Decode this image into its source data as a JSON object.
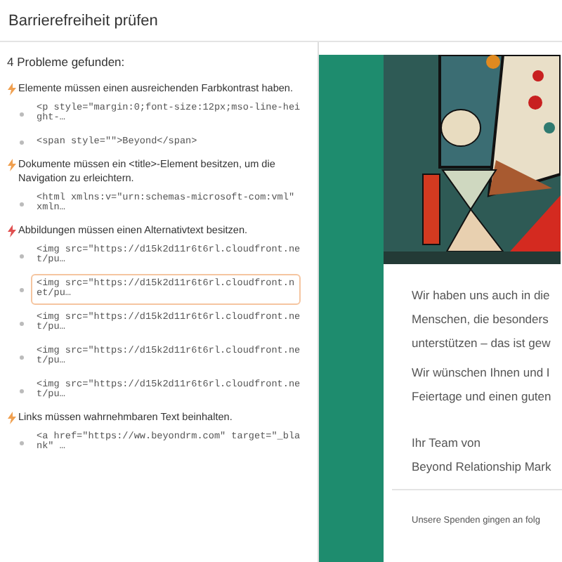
{
  "window": {
    "title": "Barrierefreiheit prüfen"
  },
  "summary": "4 Probleme gefunden:",
  "issues": [
    {
      "color": "#f0a050",
      "text": "Elemente müssen einen ausreichenden Farbkontrast haben.",
      "nodes": [
        {
          "code": "<p style=\"margin:0;font-size:12px;mso-line-height-…",
          "selected": false
        },
        {
          "code": "<span style=\"\">Beyond</span>",
          "selected": false
        }
      ]
    },
    {
      "color": "#f0a050",
      "text": "Dokumente müssen ein <title>-Element besitzen, um die Navigation zu erleichtern.",
      "nodes": [
        {
          "code": "<html xmlns:v=\"urn:schemas-microsoft-com:vml\" xmln…",
          "selected": false
        }
      ]
    },
    {
      "color": "#e05050",
      "text": "Abbildungen müssen einen Alternativtext besitzen.",
      "nodes": [
        {
          "code": "<img src=\"https://d15k2d11r6t6rl.cloudfront.net/pu…",
          "selected": false
        },
        {
          "code": "<img src=\"https://d15k2d11r6t6rl.cloudfront.net/pu…",
          "selected": true
        },
        {
          "code": "<img src=\"https://d15k2d11r6t6rl.cloudfront.net/pu…",
          "selected": false
        },
        {
          "code": "<img src=\"https://d15k2d11r6t6rl.cloudfront.net/pu…",
          "selected": false
        },
        {
          "code": "<img src=\"https://d15k2d11r6t6rl.cloudfront.net/pu…",
          "selected": false
        }
      ]
    },
    {
      "color": "#f0a050",
      "text": "Links müssen wahrnehmbaren Text beinhalten.",
      "nodes": [
        {
          "code": "<a href=\"https://ww.beyondrm.com\" target=\"_blank\" …",
          "selected": false
        }
      ]
    }
  ],
  "preview": {
    "paragraphs": [
      [
        "Wir haben uns auch in die",
        "Menschen, die besonders",
        "unterstützen – das ist gew"
      ],
      [
        "Wir wünschen Ihnen und I",
        "Feiertage und einen guten"
      ],
      [
        "Ihr Team von",
        "Beyond Relationship Mark"
      ]
    ],
    "footer": "Unsere Spenden gingen an folg"
  }
}
